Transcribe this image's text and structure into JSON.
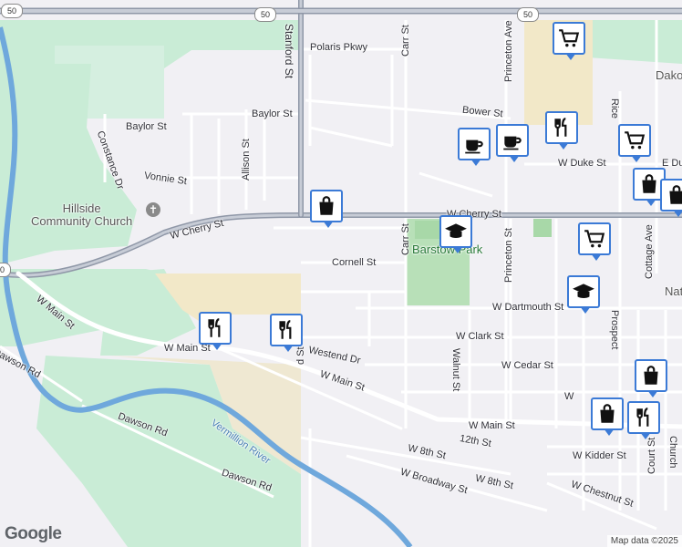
{
  "map": {
    "attribution": "Map data ©2025",
    "logo": "Google",
    "route_shields": [
      "50",
      "50",
      "50",
      "50"
    ],
    "place_labels": {
      "hillside_church": "Hillside\nCommunity Church",
      "barstow_park": "Barstow Park",
      "vermillion_river": "Vermillion River",
      "dakota_partial": "Dako",
      "nat_partial": "Nat"
    },
    "streets": {
      "polaris": "Polaris Pkwy",
      "baylor": "Baylor St",
      "bower": "Bower St",
      "w_duke": "W Duke St",
      "e_duke": "E Du",
      "vonnie": "Vonnie St",
      "allison": "Allison St",
      "constance": "Constance Dr",
      "w_cherry_west": "W Cherry St",
      "w_cherry_east": "W Cherry St",
      "cornell": "Cornell St",
      "w_dartmouth": "W Dartmouth St",
      "w_clark": "W Clark St",
      "westend": "Westend Dr",
      "w_cedar": "W Cedar St",
      "w_main_west": "W Main St",
      "w_main_mid": "W Main St",
      "w_main_center": "W Main St",
      "w_main_east": "W Main St",
      "w_partial": "W",
      "twelfth": "12th St",
      "w_8th_a": "W 8th St",
      "w_8th_b": "W 8th St",
      "w_broadway": "W Broadway St",
      "w_chestnut": "W Chestnut St",
      "w_kidder": "W Kidder St",
      "dawson_a": "Dawson Rd",
      "dawson_b": "Dawson Rd",
      "dawson_c": "Dawson Rd",
      "stanford": "Stanford St",
      "carr_n": "Carr St",
      "carr_s": "Carr St",
      "princeton_n": "Princeton Ave",
      "princeton_s": "Princeton St",
      "walnut": "Walnut St",
      "cottage": "Cottage Ave",
      "rice": "Rice",
      "prospect": "Prospect",
      "court": "Court St",
      "church": "Church",
      "d_st": "d St"
    },
    "pois": [
      {
        "name": "shopping-cart-icon"
      },
      {
        "name": "cafe-icon"
      },
      {
        "name": "cafe-icon"
      },
      {
        "name": "restaurant-icon"
      },
      {
        "name": "shopping-cart-icon"
      },
      {
        "name": "shopping-bag-icon"
      },
      {
        "name": "shopping-bag-icon"
      },
      {
        "name": "shopping-bag-icon"
      },
      {
        "name": "school-icon"
      },
      {
        "name": "shopping-cart-icon"
      },
      {
        "name": "school-icon"
      },
      {
        "name": "restaurant-icon"
      },
      {
        "name": "restaurant-icon"
      },
      {
        "name": "shopping-bag-icon"
      },
      {
        "name": "restaurant-icon"
      },
      {
        "name": "shopping-bag-icon"
      }
    ]
  }
}
